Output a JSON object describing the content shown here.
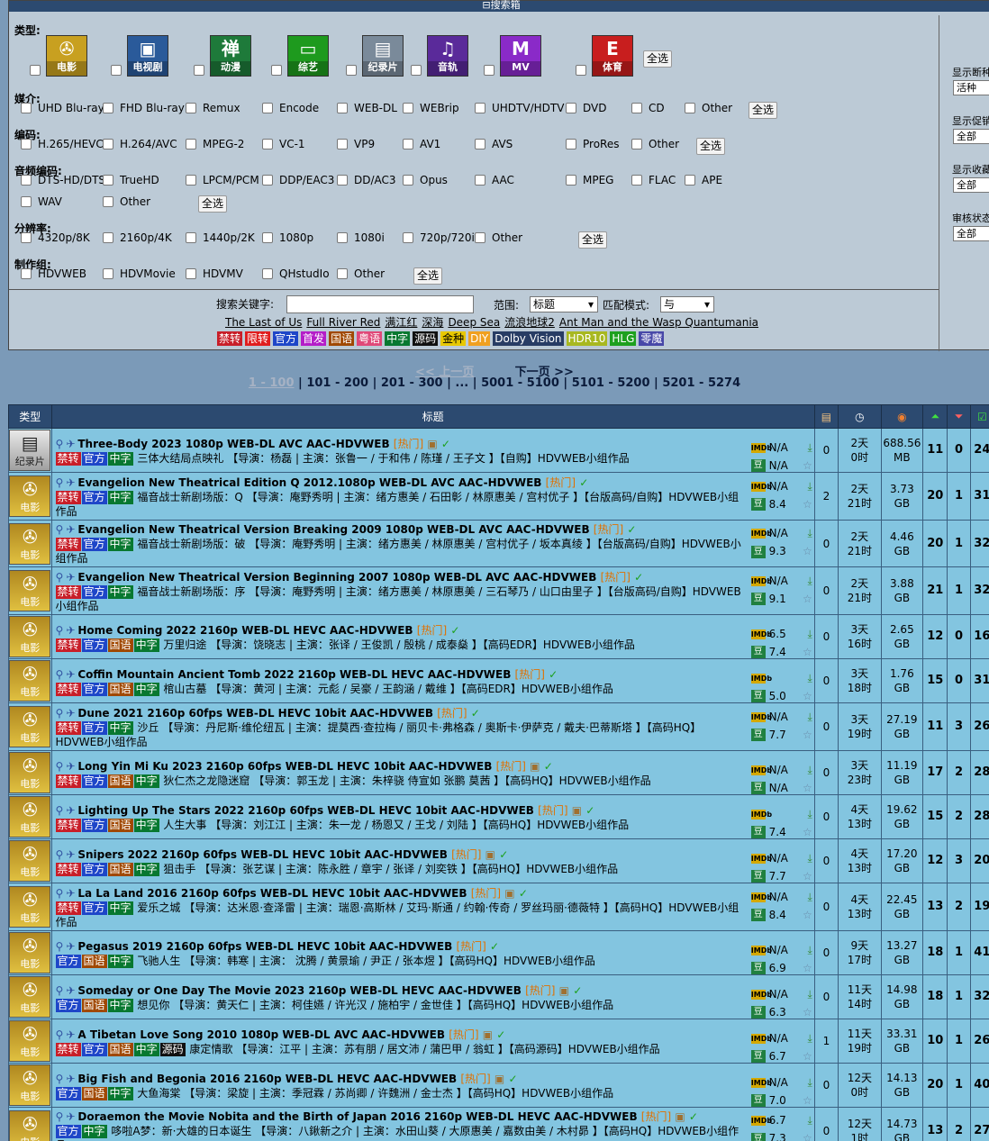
{
  "search": {
    "title": "搜索箱",
    "category_label": "类型:",
    "categories": [
      {
        "label": "电影",
        "icon": "film-reel-icon",
        "color": "#c8a020"
      },
      {
        "label": "电视剧",
        "icon": "tv-icon",
        "color": "#2a5a9a"
      },
      {
        "label": "动漫",
        "icon": "zen-icon",
        "glyph": "禅",
        "color": "#1e7a3a"
      },
      {
        "label": "综艺",
        "icon": "screen-icon",
        "color": "#1e9a1e"
      },
      {
        "label": "纪录片",
        "icon": "bbc-icon",
        "color": "#7a8a9a"
      },
      {
        "label": "音轨",
        "icon": "music-note-icon",
        "color": "#5a2a9a"
      },
      {
        "label": "MV",
        "icon": "mtv-icon",
        "color": "#8a2ac8"
      },
      {
        "label": "体育",
        "icon": "espn-icon",
        "color": "#c81e1e"
      }
    ],
    "select_all": "全选",
    "groups": [
      {
        "label": "媒介:",
        "options": [
          "UHD Blu-ray",
          "FHD Blu-ray",
          "Remux",
          "Encode",
          "WEB-DL",
          "WEBrip",
          "UHDTV/HDTV",
          "DVD",
          "CD",
          "Other"
        ]
      },
      {
        "label": "编码:",
        "options": [
          "H.265/HEVC",
          "H.264/AVC",
          "MPEG-2",
          "VC-1",
          "VP9",
          "AV1",
          "AVS",
          "ProRes",
          "Other"
        ]
      },
      {
        "label": "音频编码:",
        "options": [
          "DTS-HD/DTS",
          "TrueHD",
          "LPCM/PCM",
          "DDP/EAC3",
          "DD/AC3",
          "Opus",
          "AAC",
          "MPEG",
          "FLAC",
          "APE",
          "WAV",
          "Other"
        ]
      },
      {
        "label": "分辨率:",
        "options": [
          "4320p/8K",
          "2160p/4K",
          "1440p/2K",
          "1080p",
          "1080i",
          "720p/720i",
          "Other"
        ]
      },
      {
        "label": "制作组:",
        "options": [
          "HDVWEB",
          "HDVMovie",
          "HDVMV",
          "QHstudIo",
          "Other"
        ]
      }
    ],
    "right_panel": [
      {
        "label": "显示断种",
        "value": "活种"
      },
      {
        "label": "显示促销",
        "value": "全部"
      },
      {
        "label": "显示收藏",
        "value": "全部"
      },
      {
        "label": "审核状态",
        "value": "全部"
      }
    ],
    "keyword_label": "搜索关键字:",
    "keyword_value": "",
    "scope_label": "范围:",
    "scope_value": "标题",
    "match_label": "匹配模式:",
    "match_value": "与",
    "hot_keywords": [
      "The Last of Us",
      "Full River Red",
      "满江红",
      "深海",
      "Deep Sea",
      "流浪地球2",
      "Ant Man and the Wasp Quantumania"
    ],
    "tags": [
      {
        "text": "禁转",
        "color": "#c81e28"
      },
      {
        "text": "限转",
        "color": "#e01e1e"
      },
      {
        "text": "官方",
        "color": "#1e46c8"
      },
      {
        "text": "首发",
        "color": "#b41ec8"
      },
      {
        "text": "国语",
        "color": "#a04800"
      },
      {
        "text": "粤语",
        "color": "#e04878"
      },
      {
        "text": "中字",
        "color": "#087830"
      },
      {
        "text": "源码",
        "color": "#101010"
      },
      {
        "text": "金种",
        "color": "#e8c800",
        "fg": "#000"
      },
      {
        "text": "DIY",
        "color": "#f0a020"
      },
      {
        "text": "Dolby Vision",
        "color": "#283c64"
      },
      {
        "text": "HDR10",
        "color": "#a8b820"
      },
      {
        "text": "HLG",
        "color": "#1ea01e"
      },
      {
        "text": "零魔",
        "color": "#4848a8"
      }
    ]
  },
  "pager": {
    "prev": "<< 上一页",
    "next": "下一页 >>",
    "current": "1 - 100",
    "pages": [
      "101 - 200",
      "201 - 300",
      "...",
      "5001 - 5100",
      "5101 - 5200",
      "5201 - 5274"
    ]
  },
  "table": {
    "headers": {
      "type": "类型",
      "title": "标题"
    },
    "header_icons": [
      "comments-icon",
      "time-icon",
      "size-icon",
      "seeders-icon",
      "leechers-icon",
      "completed-icon"
    ],
    "rows": [
      {
        "cat": "纪录片",
        "title": "Three-Body 2023 1080p WEB-DL AVC AAC-HDVWEB",
        "hot": "[热门]",
        "box": true,
        "tags": [
          "禁转",
          "官方",
          "中字"
        ],
        "desc": "三体大结局点映礼 【导演：杨磊 | 主演：张鲁一 / 于和伟 / 陈瑾 / 王子文 】【自购】HDVWEB小组作品",
        "imdb": "N/A",
        "douban": "N/A",
        "comments": "0",
        "time": "2天\n0时",
        "size": "688.56\nMB",
        "seed": "11",
        "leech": "0",
        "done": "24"
      },
      {
        "cat": "电影",
        "title": "Evangelion New Theatrical Edition Q 2012.1080p WEB-DL AVC AAC-HDVWEB",
        "hot": "[热门]",
        "box": false,
        "tags": [
          "禁转",
          "官方",
          "中字"
        ],
        "desc": "福音战士新剧场版：Q 【导演：庵野秀明 | 主演：绪方惠美 / 石田彰 / 林原惠美 / 宫村优子 】【台版高码/自购】HDVWEB小组作品",
        "imdb": "N/A",
        "douban": "8.4",
        "comments": "2",
        "time": "2天\n21时",
        "size": "3.73\nGB",
        "seed": "20",
        "leech": "1",
        "done": "31"
      },
      {
        "cat": "电影",
        "title": "Evangelion New Theatrical Version Breaking 2009 1080p WEB-DL AVC AAC-HDVWEB",
        "hot": "[热门]",
        "box": false,
        "tags": [
          "禁转",
          "官方",
          "中字"
        ],
        "desc": "福音战士新剧场版：破 【导演：庵野秀明 | 主演：绪方惠美 / 林原惠美 / 宫村优子 / 坂本真绫 】【台版高码/自购】HDVWEB小组作品",
        "imdb": "N/A",
        "douban": "9.3",
        "comments": "0",
        "time": "2天\n21时",
        "size": "4.46\nGB",
        "seed": "20",
        "leech": "1",
        "done": "32"
      },
      {
        "cat": "电影",
        "title": "Evangelion New Theatrical Version Beginning 2007 1080p WEB-DL AVC AAC-HDVWEB",
        "hot": "[热门]",
        "box": false,
        "tags": [
          "禁转",
          "官方",
          "中字"
        ],
        "desc": "福音战士新剧场版：序 【导演：庵野秀明 | 主演：绪方惠美 / 林原惠美 / 三石琴乃 / 山口由里子 】【台版高码/自购】HDVWEB小组作品",
        "imdb": "N/A",
        "douban": "9.1",
        "comments": "0",
        "time": "2天\n21时",
        "size": "3.88\nGB",
        "seed": "21",
        "leech": "1",
        "done": "32"
      },
      {
        "cat": "电影",
        "title": "Home Coming 2022 2160p WEB-DL HEVC AAC-HDVWEB",
        "hot": "[热门]",
        "box": false,
        "tags": [
          "禁转",
          "官方",
          "国语",
          "中字"
        ],
        "desc": "万里归途 【导演：饶晓志 | 主演：张译 / 王俊凯 / 殷桃 / 成泰燊 】【高码EDR】HDVWEB小组作品",
        "imdb": "6.5",
        "douban": "7.4",
        "comments": "0",
        "time": "3天\n16时",
        "size": "2.65\nGB",
        "seed": "12",
        "leech": "0",
        "done": "16"
      },
      {
        "cat": "电影",
        "title": "Coffin Mountain Ancient Tomb 2022 2160p WEB-DL HEVC AAC-HDVWEB",
        "hot": "[热门]",
        "box": false,
        "tags": [
          "禁转",
          "官方",
          "国语",
          "中字"
        ],
        "desc": "棺山古墓 【导演：黄河 | 主演：元彪 / 吴豪 / 王韵涵 / 戴维 】【高码EDR】HDVWEB小组作品",
        "imdb": "",
        "douban": "5.0",
        "comments": "0",
        "time": "3天\n18时",
        "size": "1.76\nGB",
        "seed": "15",
        "leech": "0",
        "done": "31"
      },
      {
        "cat": "电影",
        "title": "Dune 2021 2160p 60fps WEB-DL HEVC 10bit AAC-HDVWEB",
        "hot": "[热门]",
        "box": false,
        "tags": [
          "禁转",
          "官方",
          "中字"
        ],
        "desc": "沙丘 【导演：丹尼斯·维伦纽瓦 | 主演：提莫西·查拉梅 / 丽贝卡·弗格森 / 奥斯卡·伊萨克 / 戴夫·巴蒂斯塔 】【高码HQ】HDVWEB小组作品",
        "imdb": "N/A",
        "douban": "7.7",
        "comments": "0",
        "time": "3天\n19时",
        "size": "27.19\nGB",
        "seed": "11",
        "leech": "3",
        "done": "26"
      },
      {
        "cat": "电影",
        "title": "Long Yin Mi Ku 2023 2160p 60fps WEB-DL HEVC 10bit AAC-HDVWEB",
        "hot": "[热门]",
        "box": true,
        "tags": [
          "禁转",
          "官方",
          "国语",
          "中字"
        ],
        "desc": "狄仁杰之龙隐迷窟 【导演：郭玉龙 | 主演：朱梓骁 侍宣如 张鹏 莫茜 】【高码HQ】HDVWEB小组作品",
        "imdb": "N/A",
        "douban": "N/A",
        "comments": "0",
        "time": "3天\n23时",
        "size": "11.19\nGB",
        "seed": "17",
        "leech": "2",
        "done": "28"
      },
      {
        "cat": "电影",
        "title": "Lighting Up The Stars 2022 2160p 60fps WEB-DL HEVC 10bit AAC-HDVWEB",
        "hot": "[热门]",
        "box": true,
        "tags": [
          "禁转",
          "官方",
          "国语",
          "中字"
        ],
        "desc": "人生大事 【导演：刘江江 | 主演：朱一龙 / 杨恩又 / 王戈 / 刘陆 】【高码HQ】HDVWEB小组作品",
        "imdb": "",
        "douban": "7.4",
        "comments": "0",
        "time": "4天\n13时",
        "size": "19.62\nGB",
        "seed": "15",
        "leech": "2",
        "done": "28"
      },
      {
        "cat": "电影",
        "title": "Snipers 2022 2160p 60fps WEB-DL HEVC 10bit AAC-HDVWEB",
        "hot": "[热门]",
        "box": true,
        "tags": [
          "禁转",
          "官方",
          "国语",
          "中字"
        ],
        "desc": "狙击手 【导演：张艺谋 | 主演：陈永胜 / 章宇 / 张译 / 刘奕铁 】【高码HQ】HDVWEB小组作品",
        "imdb": "N/A",
        "douban": "7.7",
        "comments": "0",
        "time": "4天\n13时",
        "size": "17.20\nGB",
        "seed": "12",
        "leech": "3",
        "done": "20"
      },
      {
        "cat": "电影",
        "title": "La La Land 2016 2160p 60fps WEB-DL HEVC 10bit AAC-HDVWEB",
        "hot": "[热门]",
        "box": true,
        "tags": [
          "禁转",
          "官方",
          "中字"
        ],
        "desc": "爱乐之城 【导演：达米恩·查泽雷 | 主演：瑞恩·高斯林 / 艾玛·斯通 / 约翰·传奇 / 罗丝玛丽·德薇特 】【高码HQ】HDVWEB小组作品",
        "imdb": "N/A",
        "douban": "8.4",
        "comments": "0",
        "time": "4天\n13时",
        "size": "22.45\nGB",
        "seed": "13",
        "leech": "2",
        "done": "19"
      },
      {
        "cat": "电影",
        "title": "Pegasus 2019 2160p 60fps WEB-DL HEVC 10bit AAC-HDVWEB",
        "hot": "[热门]",
        "box": false,
        "tags": [
          "官方",
          "国语",
          "中字"
        ],
        "desc": "飞驰人生 【导演：韩寒 | 主演： 沈腾 / 黄景瑜 / 尹正 / 张本煜 】【高码HQ】HDVWEB小组作品",
        "imdb": "N/A",
        "douban": "6.9",
        "comments": "0",
        "time": "9天\n17时",
        "size": "13.27\nGB",
        "seed": "18",
        "leech": "1",
        "done": "41"
      },
      {
        "cat": "电影",
        "title": "Someday or One Day The Movie 2023 2160p WEB-DL HEVC AAC-HDVWEB",
        "hot": "[热门]",
        "box": true,
        "tags": [
          "官方",
          "国语",
          "中字"
        ],
        "desc": "想见你 【导演：黄天仁 | 主演：柯佳嬿 / 许光汉 / 施柏宇 / 金世佳 】【高码HQ】HDVWEB小组作品",
        "imdb": "N/A",
        "douban": "6.3",
        "comments": "0",
        "time": "11天\n14时",
        "size": "14.98\nGB",
        "seed": "18",
        "leech": "1",
        "done": "32"
      },
      {
        "cat": "电影",
        "title": "A Tibetan Love Song 2010 1080p WEB-DL AVC AAC-HDVWEB",
        "hot": "[热门]",
        "box": true,
        "tags": [
          "禁转",
          "官方",
          "国语",
          "中字",
          "源码"
        ],
        "desc": "康定情歌 【导演：江平 | 主演：苏有朋 / 居文沛 / 蒲巴甲 / 翁虹 】【高码源码】HDVWEB小组作品",
        "imdb": "N/A",
        "douban": "6.7",
        "comments": "1",
        "time": "11天\n19时",
        "size": "33.31\nGB",
        "seed": "10",
        "leech": "1",
        "done": "26"
      },
      {
        "cat": "电影",
        "title": "Big Fish and Begonia 2016 2160p WEB-DL HEVC AAC-HDVWEB",
        "hot": "[热门]",
        "box": true,
        "tags": [
          "官方",
          "国语",
          "中字"
        ],
        "desc": "大鱼海棠 【导演：梁旋 | 主演：季冠霖 / 苏尚卿 / 许魏洲 / 金士杰 】【高码HQ】HDVWEB小组作品",
        "imdb": "N/A",
        "douban": "7.0",
        "comments": "0",
        "time": "12天\n0时",
        "size": "14.13\nGB",
        "seed": "20",
        "leech": "1",
        "done": "40"
      },
      {
        "cat": "电影",
        "title": "Doraemon the Movie Nobita and the Birth of Japan 2016 2160p WEB-DL HEVC AAC-HDVWEB",
        "hot": "[热门]",
        "box": true,
        "tags": [
          "官方",
          "中字"
        ],
        "desc": "哆啦A梦：新·大雄的日本诞生 【导演：八鍬新之介 | 主演：水田山葵 / 大原惠美 / 嘉数由美 / 木村昴 】【高码HQ】HDVWEB小组作品",
        "imdb": "6.7",
        "douban": "7.3",
        "comments": "0",
        "time": "12天\n1时",
        "size": "14.73\nGB",
        "seed": "13",
        "leech": "2",
        "done": "27"
      }
    ]
  }
}
